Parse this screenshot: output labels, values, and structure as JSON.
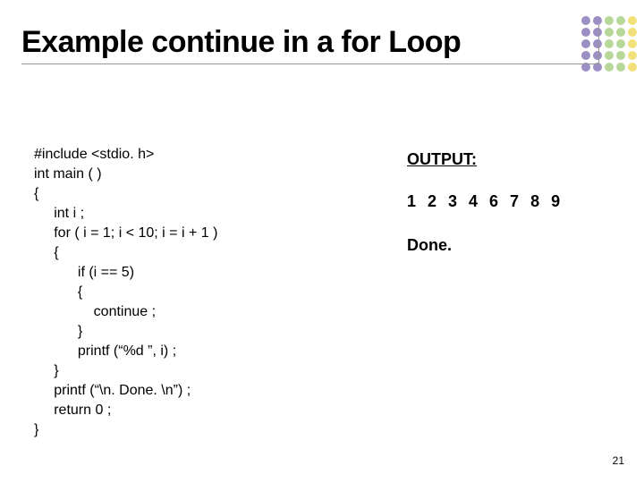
{
  "title": "Example continue in a for Loop",
  "code_line01": "#include <stdio. h>",
  "code_line02": "int main ( )",
  "code_line03": "{",
  "code_line04": "     int i ;",
  "code_line05": "     for ( i = 1; i < 10; i = i + 1 )",
  "code_line06": "     {",
  "code_line07": "           if (i == 5)",
  "code_line08": "           {",
  "code_line09": "               continue ;",
  "code_line10": "           }",
  "code_line11": "           printf (“%d ”, i) ;",
  "code_line12": "     }",
  "code_line13": "     printf (“\\n. Done. \\n”) ;",
  "code_line14": "     return 0 ;",
  "code_line15": "}",
  "output_header": "OUTPUT:",
  "output_numbers": "1 2 3 4 6 7 8 9",
  "output_done": "Done.",
  "page_number": "21",
  "dot_colors": {
    "purple": "#9b8fc4",
    "green": "#b8d89a",
    "yellow": "#f2e07a"
  }
}
